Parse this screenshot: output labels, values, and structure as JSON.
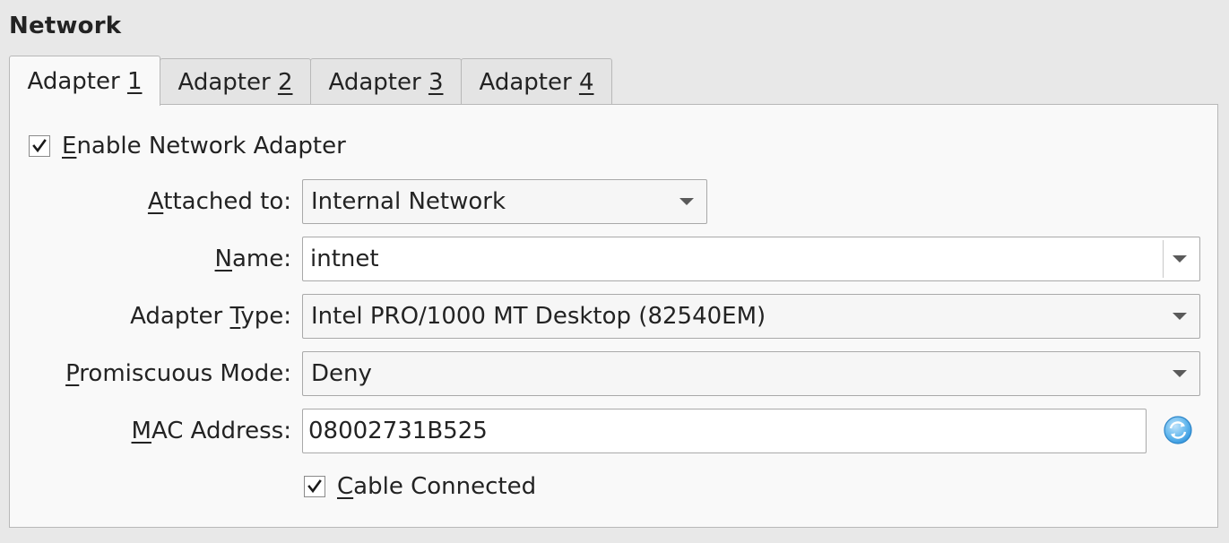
{
  "section": {
    "title": "Network"
  },
  "tabs": [
    {
      "prefix": "Adapter ",
      "mnemonic": "1"
    },
    {
      "prefix": "Adapter ",
      "mnemonic": "2"
    },
    {
      "prefix": "Adapter ",
      "mnemonic": "3"
    },
    {
      "prefix": "Adapter ",
      "mnemonic": "4"
    }
  ],
  "active_tab": "Adapter 1",
  "enable_adapter": {
    "mnemonic": "E",
    "rest": "nable Network Adapter",
    "checked": true
  },
  "attached_to": {
    "label_mnemonic": "A",
    "label_rest": "ttached to:",
    "value": "Internal Network"
  },
  "name": {
    "label_mnemonic": "N",
    "label_rest": "ame:",
    "value": "intnet"
  },
  "adapter_type": {
    "label_prefix": "Adapter ",
    "label_mnemonic": "T",
    "label_rest": "ype:",
    "value": "Intel PRO/1000 MT Desktop (82540EM)"
  },
  "promiscuous_mode": {
    "label_mnemonic": "P",
    "label_rest": "romiscuous Mode:",
    "value": "Deny"
  },
  "mac_address": {
    "label_mnemonic": "M",
    "label_rest": "AC Address:",
    "value": "08002731B525"
  },
  "cable_connected": {
    "mnemonic": "C",
    "rest": "able Connected",
    "checked": true
  },
  "icons": {
    "checkmark": "check-icon",
    "dropdown": "chevron-down-icon",
    "refresh": "refresh-icon"
  },
  "colors": {
    "refresh_accent": "#3a9be0"
  }
}
